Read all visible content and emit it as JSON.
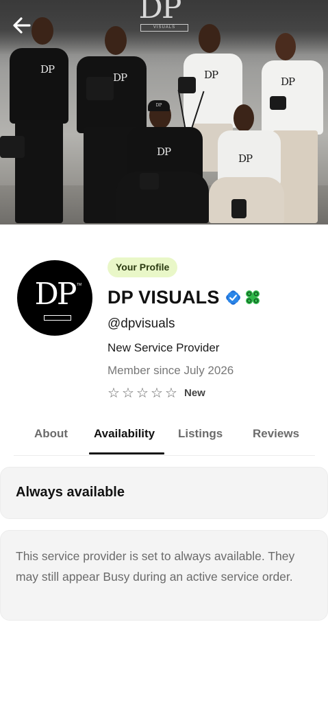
{
  "hero": {
    "wall_logo": "DP",
    "wall_logo_sub": "VISUALS",
    "shirt_logo": "DP",
    "cap_logo": "DP"
  },
  "profile": {
    "avatar_logo": "DP",
    "avatar_tm": "TM",
    "badge": "Your Profile",
    "name": "DP VISUALS",
    "handle": "@dpvisuals",
    "role": "New Service Provider",
    "member_since": "Member since July 2026",
    "stars": [
      "☆",
      "☆",
      "☆",
      "☆",
      "☆"
    ],
    "rating_label": "New",
    "icons": {
      "verified": "verified-badge-icon",
      "seal": "green-seal-icon",
      "back": "back-arrow-icon"
    }
  },
  "tabs": [
    {
      "label": "About",
      "active": false
    },
    {
      "label": "Availability",
      "active": true
    },
    {
      "label": "Listings",
      "active": false
    },
    {
      "label": "Reviews",
      "active": false
    }
  ],
  "availability": {
    "title": "Always available",
    "description": "This service provider is set to always available. They may still appear Busy during an active service order."
  },
  "colors": {
    "badge_bg": "#e9f7c8",
    "verified_blue": "#1f6fd6",
    "seal_green": "#2fb84a",
    "card_bg": "#f4f4f4"
  }
}
